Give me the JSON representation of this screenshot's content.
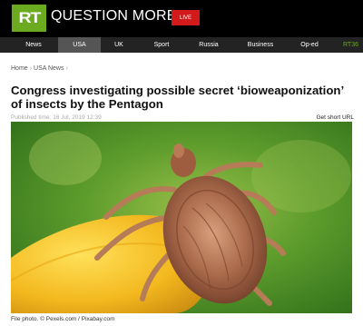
{
  "header": {
    "logo_text": "RT",
    "tagline": "QUESTION MORE",
    "live_label": "LIVE",
    "brand_color": "#6cab1f",
    "live_color": "#d21a1a"
  },
  "nav": {
    "items": [
      {
        "label": "News"
      },
      {
        "label": "USA",
        "active": true
      },
      {
        "label": "UK"
      },
      {
        "label": "Sport"
      },
      {
        "label": "Russia"
      },
      {
        "label": "Business"
      },
      {
        "label": "Op-ed"
      },
      {
        "label": "RT36"
      }
    ]
  },
  "breadcrumbs": {
    "home": "Home",
    "section": "USA News"
  },
  "article": {
    "title": "Congress investigating possible secret ‘bioweaponization’ of insects by the Pentagon",
    "published": "Published time: 16 Jul, 2019 12:39",
    "short_url": "Get short URL",
    "image_icon": "tick-photo",
    "caption": "File photo. © Pexels.com / Pixabay.com"
  }
}
